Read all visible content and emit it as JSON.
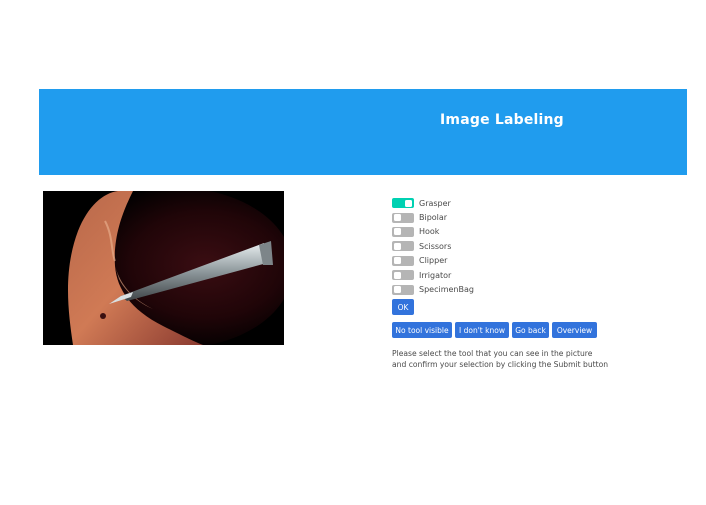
{
  "header": {
    "title": "Image Labeling",
    "background": "#209cee"
  },
  "tools": [
    {
      "label": "Grasper",
      "checked": true
    },
    {
      "label": "Bipolar",
      "checked": false
    },
    {
      "label": "Hook",
      "checked": false
    },
    {
      "label": "Scissors",
      "checked": false
    },
    {
      "label": "Clipper",
      "checked": false
    },
    {
      "label": "Irrigator",
      "checked": false
    },
    {
      "label": "SpecimenBag",
      "checked": false
    }
  ],
  "actions": {
    "ok": "OK",
    "no_tool": "No tool visible",
    "dont_know": "I don't know",
    "go_back": "Go back",
    "overview": "Overview"
  },
  "instructions": {
    "line1": "Please select the tool that you can see in the picture",
    "line2": "and confirm your selection by clicking the Submit button"
  },
  "colors": {
    "accent": "#3273dc",
    "toggle_on": "#00d1b2",
    "toggle_off": "#b5b5b5"
  }
}
